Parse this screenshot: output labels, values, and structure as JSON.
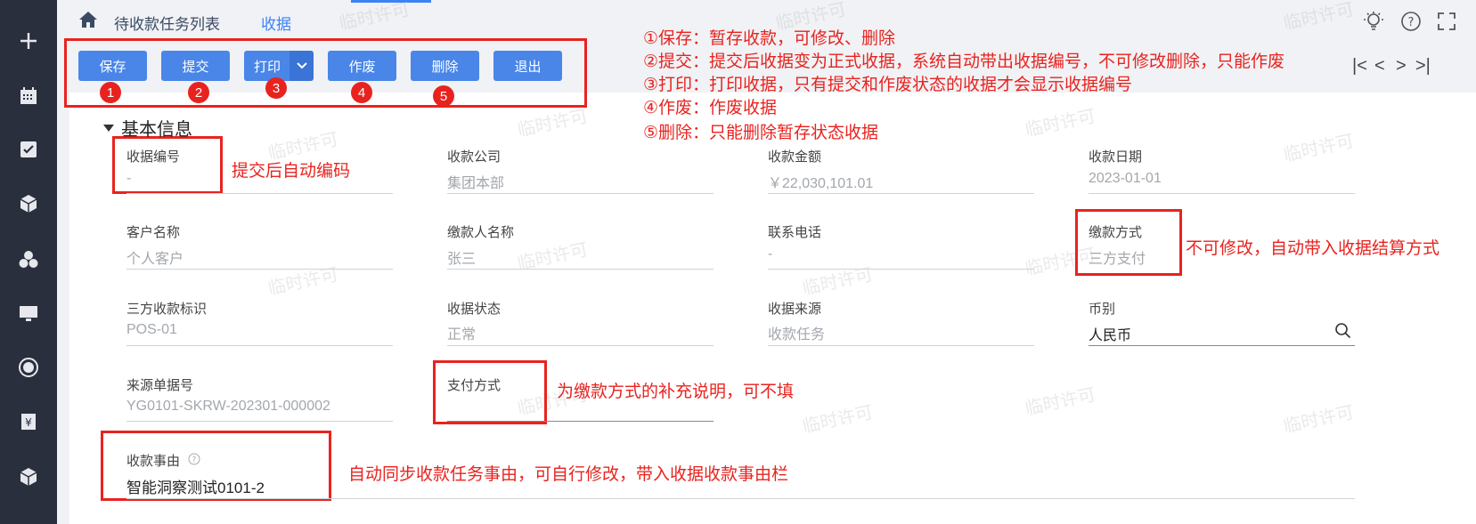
{
  "breadcrumb": {
    "parent": "待收款任务列表",
    "current": "收据"
  },
  "toolbar": {
    "save": "保存",
    "submit": "提交",
    "print": "打印",
    "void": "作废",
    "delete": "删除",
    "exit": "退出",
    "badges": [
      "1",
      "2",
      "3",
      "4",
      "5"
    ]
  },
  "pager": {
    "first": "|<",
    "prev": "<",
    "next": ">",
    "last": ">|"
  },
  "annotations": {
    "save": "①保存：暂存收款，可修改、删除",
    "submit": "②提交：提交后收据变为正式收据，系统自动带出收据编号，不可修改删除，只能作废",
    "print": "③打印：打印收据，只有提交和作废状态的收据才会显示收据编号",
    "void": "④作废：作废收据",
    "delete": "⑤删除：只能删除暂存状态收据",
    "receipt_no": "提交后自动编码",
    "payment_method": "不可修改，自动带入收据结算方式",
    "pay_mode": "为缴款方式的补充说明，可不填",
    "reason": "自动同步收款任务事由，可自行修改，带入收据收款事由栏"
  },
  "section": {
    "title": "基本信息"
  },
  "fields": {
    "receipt_no": {
      "label": "收据编号",
      "value": "-"
    },
    "company": {
      "label": "收款公司",
      "value": "集团本部"
    },
    "amount": {
      "label": "收款金额",
      "value": "￥22,030,101.01"
    },
    "date": {
      "label": "收款日期",
      "value": "2023-01-01"
    },
    "customer": {
      "label": "客户名称",
      "value": "个人客户"
    },
    "payer": {
      "label": "缴款人名称",
      "value": "张三"
    },
    "phone": {
      "label": "联系电话",
      "value": "-"
    },
    "payment_method": {
      "label": "缴款方式",
      "value": "三方支付"
    },
    "third_party_id": {
      "label": "三方收款标识",
      "value": "POS-01"
    },
    "status": {
      "label": "收据状态",
      "value": "正常"
    },
    "source": {
      "label": "收据来源",
      "value": "收款任务"
    },
    "currency": {
      "label": "币别",
      "value": "人民币"
    },
    "source_doc": {
      "label": "来源单据号",
      "value": "YG0101-SKRW-202301-000002"
    },
    "pay_mode": {
      "label": "支付方式",
      "value": ""
    },
    "reason": {
      "label": "收款事由",
      "value": "智能洞察测试0101-2"
    }
  },
  "watermark": "临时许可",
  "colors": {
    "primary_button": "#4a86e8",
    "annotation_red": "#e8231f",
    "rail": "#2a2f3d"
  }
}
